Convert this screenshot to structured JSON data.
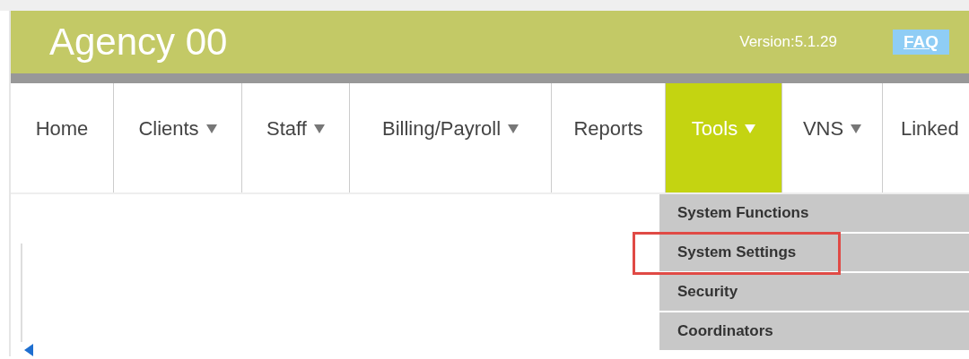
{
  "header": {
    "title": "Agency 00",
    "version": "Version:5.1.29",
    "faq": "FAQ"
  },
  "nav": [
    {
      "label": "Home",
      "dropdown": false,
      "selected": false
    },
    {
      "label": "Clients",
      "dropdown": true,
      "selected": false
    },
    {
      "label": "Staff",
      "dropdown": true,
      "selected": false
    },
    {
      "label": "Billing/Payroll",
      "dropdown": true,
      "selected": false
    },
    {
      "label": "Reports",
      "dropdown": false,
      "selected": false
    },
    {
      "label": "Tools",
      "dropdown": true,
      "selected": true
    },
    {
      "label": "VNS",
      "dropdown": true,
      "selected": false
    },
    {
      "label": "Linked",
      "dropdown": false,
      "selected": false
    }
  ],
  "menu": [
    {
      "label": "System Functions",
      "highlighted": false
    },
    {
      "label": "System Settings",
      "highlighted": true
    },
    {
      "label": "Security",
      "highlighted": false
    },
    {
      "label": "Coordinators",
      "highlighted": false
    }
  ]
}
